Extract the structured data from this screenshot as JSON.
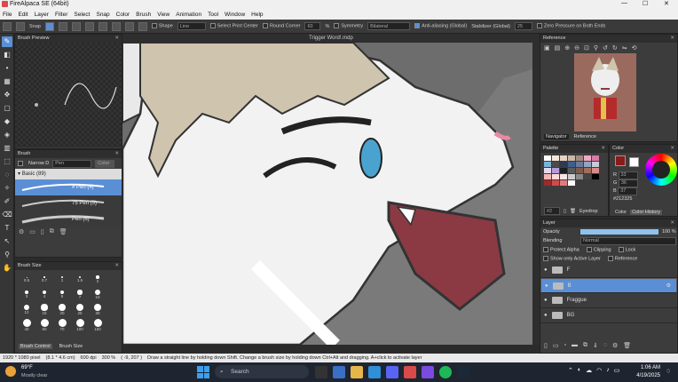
{
  "window": {
    "title": "FireAlpaca SE (64bit)"
  },
  "menu": [
    "File",
    "Edit",
    "Layer",
    "Filter",
    "Select",
    "Snap",
    "Color",
    "Brush",
    "View",
    "Animation",
    "Tool",
    "Window",
    "Help"
  ],
  "toolbar": {
    "snap_label": "Snap",
    "shape_label": "Shape",
    "shape_value": "Line",
    "select_print_center": "Select Print Center",
    "round_corner": "Round Corner",
    "round_corner_value": "60",
    "percent": "%",
    "symmetry_label": "Symmetry",
    "symmetry_value": "Bilateral",
    "anti_aliasing": "Anti-aliasing (Global)",
    "stabilizer_label": "Stabilizer (Global)",
    "stabilizer_value": "25",
    "zero_pressure": "Zero Pressure on Both Ends"
  },
  "canvas": {
    "tab_title": "Trigger Word!.mdp"
  },
  "brush_preview": {
    "title": "Brush Preview"
  },
  "brush": {
    "title": "Brush",
    "narrow_label": "Narrow D",
    "pen_value": "Pen",
    "color_label": "Color",
    "group_label": "Basic (89)",
    "items": [
      {
        "name": "# Pen (4)"
      },
      {
        "name": "75 Pen (5)"
      },
      {
        "name": "Pen (6)"
      }
    ]
  },
  "brush_size": {
    "title": "Brush Size",
    "sizes": [
      "0.5",
      "0.7",
      "1",
      "1.5",
      "2",
      "3",
      "4",
      "5",
      "7",
      "10",
      "12",
      "15",
      "20",
      "25",
      "30",
      "40",
      "50",
      "70",
      "100",
      "150"
    ],
    "tabs": [
      "Brush Control",
      "Brush Size"
    ]
  },
  "reference": {
    "title": "Reference",
    "tabs": [
      "Navigator",
      "Reference"
    ]
  },
  "palette": {
    "title": "Palette",
    "colors": [
      "#ffffff",
      "#f4e6d8",
      "#e9d2c4",
      "#c9b7a8",
      "#9e8a80",
      "#f1a7c6",
      "#d97aa4",
      "#7ab3d8",
      "#4b4b4b",
      "#2f3a52",
      "#3e5f8a",
      "#6a7a9a",
      "#90a6c0",
      "#c8c8d8",
      "#e5d9f0",
      "#b59bd8",
      "#1e1e1e",
      "#5a5a5a",
      "#7b5b4b",
      "#a36c5c",
      "#d48a8a",
      "#f4b6b6",
      "#ffd9d9",
      "#f7e5e5",
      "#cccccc",
      "#888888",
      "#444444",
      "#000000",
      "#9c2b2b",
      "#d24a4a",
      "#e57a7a",
      "#ffffff"
    ],
    "eyedrop_label": "Eyedrop",
    "index_label": "#2"
  },
  "color": {
    "title": "Color",
    "r": "33",
    "g": "36",
    "b": "37",
    "hex": "#212325",
    "tabs": [
      "Color",
      "Color History"
    ]
  },
  "layer": {
    "title": "Layer",
    "opacity_label": "Opacity",
    "opacity_value": "100 %",
    "opacity_fraction": 1.0,
    "blending_label": "Blending",
    "blending_value": "Normal",
    "protect_alpha": "Protect Alpha",
    "clipping": "Clipping",
    "lock": "Lock",
    "show_only_active": "Show only Active Layer",
    "reference": "Reference",
    "rows": [
      {
        "name": "F"
      },
      {
        "name": "B"
      },
      {
        "name": "Fraggue"
      },
      {
        "name": "BG"
      }
    ]
  },
  "status": {
    "size": "1920 * 1080 pixel",
    "dims": "(8.1 * 4.6 cm)",
    "dpi": "600 dpi",
    "zoom": "300 %",
    "coords": "( -9, 207 )",
    "hint": "Draw a straight line by holding down Shift. Change a brush size by holding down Ctrl+Alt and dragging. A+click to activate layer"
  },
  "taskbar": {
    "weather_temp": "69°F",
    "weather_desc": "Mostly clear",
    "search": "Search",
    "time": "1:06 AM",
    "date": "4/19/2025"
  },
  "colors": {
    "accent": "#5a8fd6",
    "fg_color": "#8b1a1a",
    "bg_color": "#ffffff"
  }
}
